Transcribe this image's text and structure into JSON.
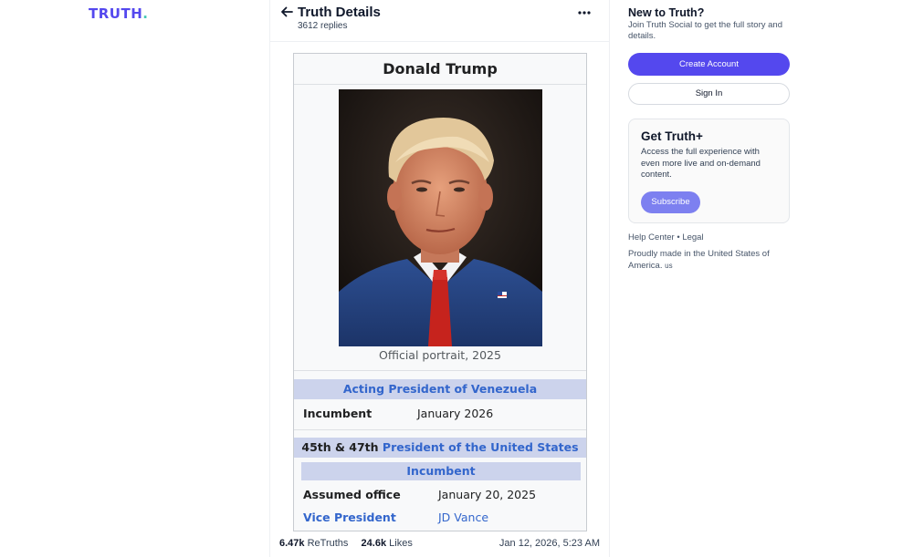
{
  "logo": {
    "text": "TRUTH",
    "dot": "."
  },
  "header": {
    "title": "Truth Details",
    "replies": "3612 replies"
  },
  "infobox": {
    "name": "Donald Trump",
    "caption": "Official portrait, 2025",
    "office1": "Acting President of Venezuela",
    "incumbent_label": "Incumbent",
    "incumbent_date": "January 2026",
    "office2_prefix": "45th & 47th",
    "office2": "President of the United States",
    "incumbent2": "Incumbent",
    "assumed_label": "Assumed office",
    "assumed_date": "January 20, 2025",
    "vp_label": "Vice President",
    "vp_name": "JD Vance"
  },
  "stats": {
    "retruths_count": "6.47k",
    "retruths_label": "ReTruths",
    "likes_count": "24.6k",
    "likes_label": "Likes",
    "timestamp": "Jan 12, 2026, 5:23 AM"
  },
  "sidebar": {
    "title": "New to Truth?",
    "text": "Join Truth Social to get the full story and details.",
    "create_account": "Create Account",
    "sign_in": "Sign In",
    "plus_title": "Get Truth+",
    "plus_text": "Access the full experience with even more live and on-demand content.",
    "subscribe": "Subscribe",
    "help": "Help Center",
    "bullet": "•",
    "legal": "Legal",
    "made": "Proudly made in the United States of America.",
    "country": "us"
  },
  "icons": {
    "back": "arrow-left-icon",
    "more": "more-horizontal-icon"
  },
  "colors": {
    "brand": "#5448ee",
    "brand_dot": "#45c8b6",
    "link": "#3366cc",
    "band": "#ccd3ec",
    "subscribe": "#7d80f0"
  }
}
